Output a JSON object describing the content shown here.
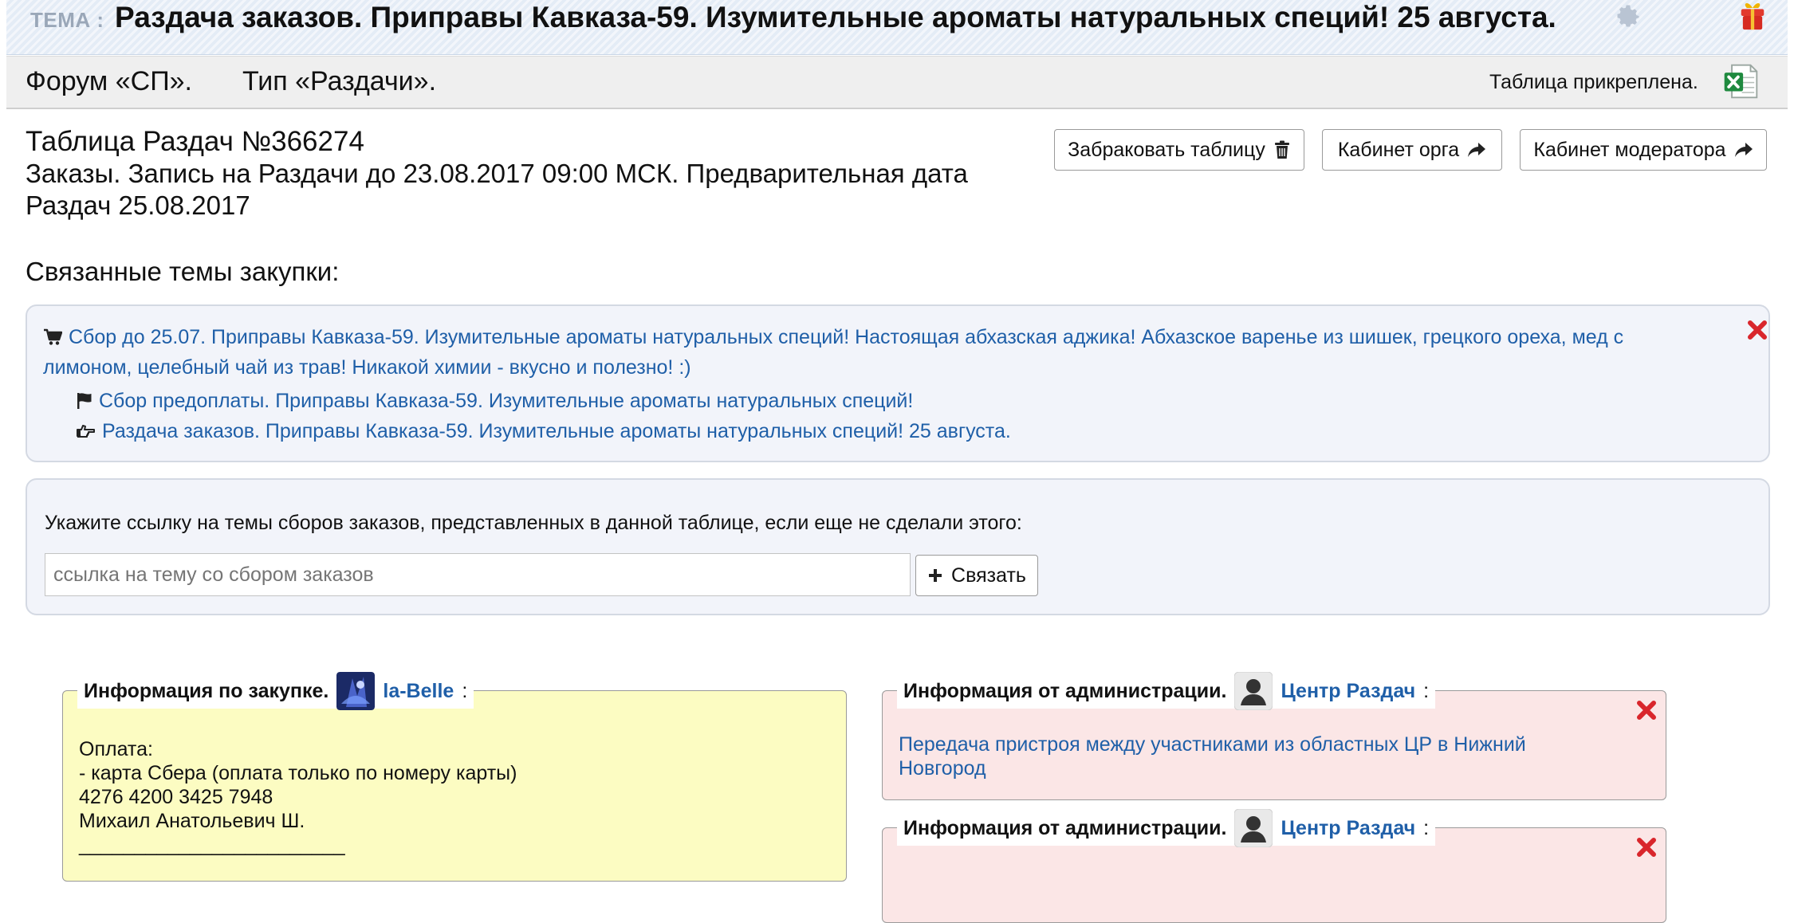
{
  "topic": {
    "label": "ТЕМА :",
    "title": "Раздача заказов. Приправы Кавказа-59. Изумительные ароматы натуральных специй! 25 августа."
  },
  "forum": {
    "crumb1": "Форум «СП».",
    "crumb2": "Тип «Раздачи».",
    "attached_label": "Таблица прикреплена."
  },
  "table": {
    "title": "Таблица Раздач №366274",
    "subtitle": "Заказы. Запись на Раздачи до 23.08.2017 09:00 МСК. Предварительная дата Раздач 25.08.2017"
  },
  "actions": {
    "reject_label": "Забраковать таблицу",
    "org_cabinet_label": "Кабинет орга",
    "moderator_cabinet_label": "Кабинет модератора"
  },
  "related": {
    "heading": "Связанные темы закупки:",
    "items": [
      {
        "icon": "cart-icon",
        "text": "Сбор до 25.07. Приправы Кавказа-59. Изумительные ароматы натуральных специй! Настоящая абхазская аджика! Абхазское варенье из шишек, грецкого ореха, мед с лимоном, целебный чай из трав! Никакой химии - вкусно и полезно! :)"
      },
      {
        "icon": "flag-icon",
        "text": "Сбор предоплаты. Приправы Кавказа-59. Изумительные ароматы натуральных специй!"
      },
      {
        "icon": "hand-pointer-icon",
        "text": "Раздача заказов. Приправы Кавказа-59. Изумительные ароматы натуральных специй! 25 августа."
      }
    ]
  },
  "link_form": {
    "label": "Укажите ссылку на темы сборов заказов, представленных в данной таблице, если еще не сделали этого:",
    "placeholder": "ссылка на тему со сбором заказов",
    "button_label": "Связать"
  },
  "purchase_info": {
    "heading": "Информация по закупке.",
    "user": "la-Belle",
    "colon": ":",
    "lines": [
      "Оплата:",
      "- карта Сбера (оплата только по номеру карты)",
      "4276 4200 3425 7948",
      "Михаил Анатольевич Ш.",
      "________________________"
    ]
  },
  "admin_info": [
    {
      "heading": "Информация от администрации.",
      "user": "Центр Раздач",
      "colon": ":",
      "text": "Передача пристроя между участниками из областных ЦР в Нижний Новгород"
    },
    {
      "heading": "Информация от администрации.",
      "user": "Центр Раздач",
      "colon": ":",
      "text": ""
    }
  ],
  "colors": {
    "link": "#1f5fa8",
    "topic_bar": "#e4ecf6",
    "purchase_box": "#fcfcc2",
    "admin_box": "#fbe6e6",
    "close": "#d9262c"
  }
}
